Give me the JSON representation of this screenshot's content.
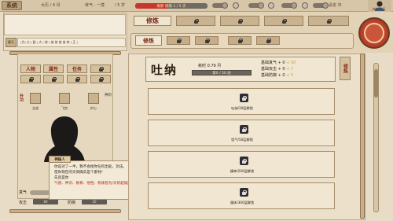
{
  "topbar": {
    "system_label": "系统",
    "date": "大历 / 4 月",
    "lifespan": "体气 - 一境",
    "age": "/ 5 岁",
    "cultivation_label": "刷新 修炼 1 / 5 次",
    "xp_text": "0",
    "xp_percent": 45,
    "options_label": "设定 中",
    "calendar_label": "神都 某日"
  },
  "left": {
    "chat_text": "(为) 大 ( 副 ) 大 ( 修 ) 某 修 某 某 转 ( 正 )",
    "fold_label": "聊天",
    "tabs": [
      "人物",
      "属性",
      "任务"
    ],
    "slots_label": "外功",
    "slots": [
      {
        "label": "全战"
      },
      {
        "label": "飞剑"
      },
      {
        "label": "护心"
      }
    ],
    "slot_right_label": "神识",
    "npc_name": "神秘人",
    "dialog": [
      "你说对了一半，我不会给你任何出处，功法。",
      "但你现在的天资确实是个废材！",
      "先且是你",
      "气感、神识、根骨、悟性、机缘皆为/天的超级废材！"
    ],
    "stat_qi_label": "真气",
    "stat_attack_label": "攻击",
    "stat_attack_value": "60",
    "stat_defense_label": "防御",
    "stat_defense_value": "20"
  },
  "right": {
    "top_tag": "修炼",
    "second_tag": "修炼",
    "technique_title": "吐纳",
    "cost": "耗时 0.79 月",
    "progress_text": "第0 / 50 层",
    "progress_percent": 0,
    "stats": [
      {
        "label": "基础真气",
        "value": "+ 0",
        "plus": "+ 50"
      },
      {
        "label": "基础攻击",
        "value": "+ 0",
        "plus": "+ 7"
      },
      {
        "label": "基础防御",
        "value": "+ 0",
        "plus": "+ 5"
      }
    ],
    "side_button": "修炼",
    "rows": [
      {
        "text": "吐纳/20层解锁"
      },
      {
        "text": "悟气/50层解锁"
      },
      {
        "text": "鍊神/200层解锁"
      },
      {
        "text": "遁体/300层解锁"
      }
    ]
  },
  "colors": {
    "accent": "#8a2b1e",
    "progress_red": "#c9362e",
    "panel": "#ece0ca"
  }
}
